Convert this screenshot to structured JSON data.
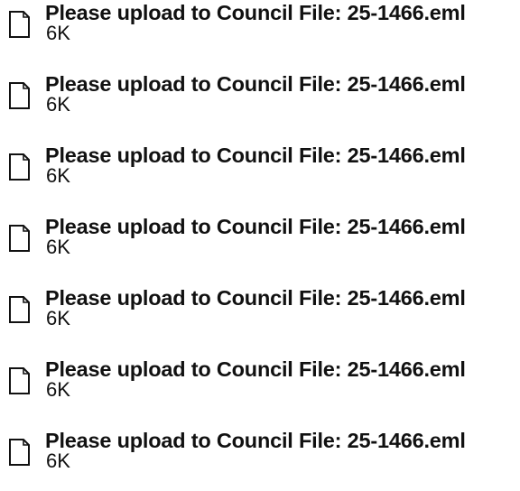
{
  "attachments": [
    {
      "name": "Please upload to Council File: 25-1466.eml",
      "size": "6K",
      "icon": "file-icon"
    },
    {
      "name": "Please upload to Council File: 25-1466.eml",
      "size": "6K",
      "icon": "file-icon"
    },
    {
      "name": "Please upload to Council File: 25-1466.eml",
      "size": "6K",
      "icon": "file-icon"
    },
    {
      "name": "Please upload to Council File: 25-1466.eml",
      "size": "6K",
      "icon": "file-icon"
    },
    {
      "name": "Please upload to Council File: 25-1466.eml",
      "size": "6K",
      "icon": "file-icon"
    },
    {
      "name": "Please upload to Council File: 25-1466.eml",
      "size": "6K",
      "icon": "file-icon"
    },
    {
      "name": "Please upload to Council File: 25-1466.eml",
      "size": "6K",
      "icon": "file-icon"
    }
  ]
}
